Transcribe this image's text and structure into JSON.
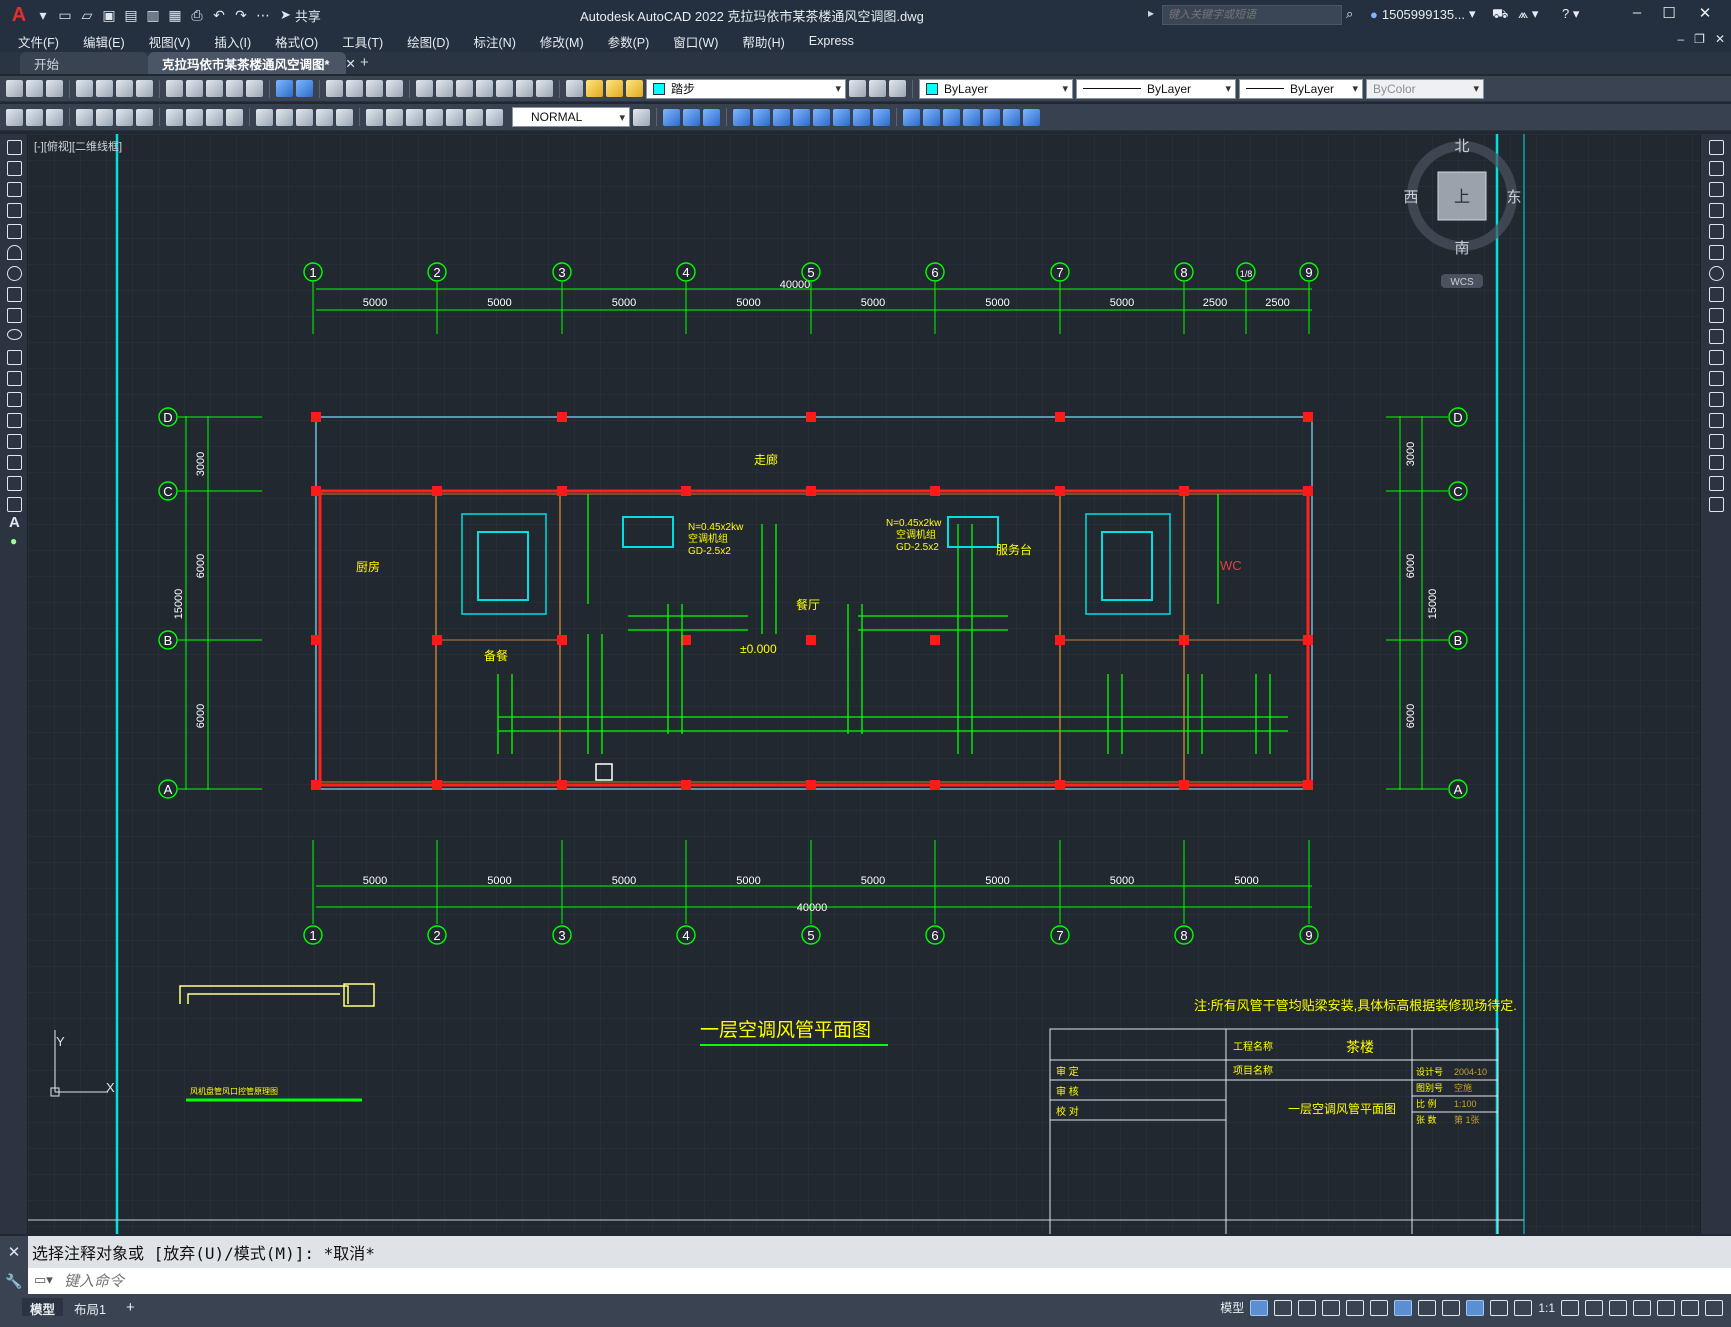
{
  "titlebar": {
    "logo": "A",
    "share_label": "共享",
    "title": "Autodesk AutoCAD 2022    克拉玛依市某茶楼通风空调图.dwg",
    "search_placeholder": "键入关键字或短语",
    "user_name": "1505999135...",
    "cart_icon": "cart-icon",
    "help_icon": "help-icon"
  },
  "menu": {
    "items": [
      "文件(F)",
      "编辑(E)",
      "视图(V)",
      "插入(I)",
      "格式(O)",
      "工具(T)",
      "绘图(D)",
      "标注(N)",
      "修改(M)",
      "参数(P)",
      "窗口(W)",
      "帮助(H)",
      "Express"
    ]
  },
  "tabs": {
    "start": "开始",
    "active": "克拉玛依市某茶楼通风空调图*"
  },
  "toolbar": {
    "layer_name": "踏步",
    "linetype_style": "NORMAL",
    "color": "ByLayer",
    "linetype": "ByLayer",
    "lineweight": "ByLayer",
    "plotstyle": "ByColor"
  },
  "viewport": {
    "label": "[-][俯视][二维线框]"
  },
  "viewcube": {
    "north": "北",
    "south": "南",
    "east": "东",
    "west": "西",
    "face": "上",
    "wcs": "WCS"
  },
  "drawing": {
    "grid_top": [
      "1",
      "2",
      "3",
      "4",
      "5",
      "6",
      "7",
      "8",
      "1/8",
      "9"
    ],
    "grid_bottom": [
      "1",
      "2",
      "3",
      "4",
      "5",
      "6",
      "7",
      "8",
      "9"
    ],
    "grid_rows": [
      "D",
      "C",
      "B",
      "A"
    ],
    "dim_top": [
      "5000",
      "5000",
      "5000",
      "5000",
      "5000",
      "5000",
      "5000",
      "2500",
      "2500"
    ],
    "dim_bottom": [
      "5000",
      "5000",
      "5000",
      "5000",
      "5000",
      "5000",
      "5000",
      "5000"
    ],
    "total": "40000",
    "dim_left": [
      "3000",
      "6000",
      "6000"
    ],
    "total_left": "15000",
    "rooms": {
      "kitchen": "厨房",
      "corridor": "走廊",
      "dining": "餐厅",
      "prep": "备餐",
      "service": "服务台",
      "wc": "WC",
      "level": "±0.000"
    },
    "ahu_label_1": "N=0.45x2kw",
    "ahu_label_2": "空调机组",
    "ahu_label_3": "GD-2.5x2",
    "drawing_title": "一层空调风管平面图",
    "note": "注:所有风管干管均贴梁安装,具体标高根据装修现场待定.",
    "titleblock": {
      "project_label": "工程名称",
      "project": "茶楼",
      "item_label": "项目名称",
      "sheet_title": "一层空调风管平面图",
      "rows": [
        "审 定",
        "审 核",
        "校 对"
      ],
      "right_rows": [
        "设计号",
        "图别号",
        "比 例",
        "张 数"
      ],
      "right_values": [
        "2004-10",
        "空施",
        "1:100",
        "第 1张"
      ]
    },
    "legend_note": "风机盘管风口控管原理图"
  },
  "command": {
    "history": "选择注释对象或 [放弃(U)/模式(M)]: *取消*",
    "placeholder": "键入命令"
  },
  "status": {
    "model_tab": "模型",
    "layout_tab": "布局1",
    "space": "模型",
    "scale": "1:1"
  }
}
